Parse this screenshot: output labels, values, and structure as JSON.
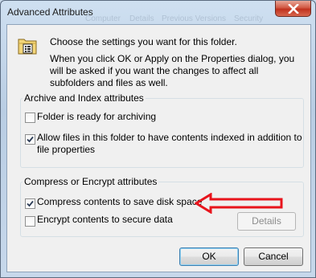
{
  "window": {
    "title": "Advanced Attributes",
    "background_ghost_text": [
      "Computer",
      "Details",
      "Previous Versions",
      "Security"
    ]
  },
  "info": {
    "line1": "Choose the settings you want for this folder.",
    "line2": "When you click OK or Apply on the Properties dialog, you will be asked if you want the changes to affect all subfolders and files as well."
  },
  "archive_group": {
    "label": "Archive and Index attributes",
    "folder_ready_archiving": {
      "label": "Folder is ready for archiving",
      "checked": false
    },
    "allow_indexing": {
      "label": "Allow files in this folder to have contents indexed in addition to file properties",
      "checked": true
    }
  },
  "compress_group": {
    "label": "Compress or Encrypt attributes",
    "compress": {
      "label": "Compress contents to save disk space",
      "checked": true
    },
    "encrypt": {
      "label": "Encrypt contents to secure data",
      "checked": false
    },
    "details_label": "Details"
  },
  "buttons": {
    "ok": "OK",
    "cancel": "Cancel"
  },
  "colors": {
    "annotation_arrow": "#e8141c",
    "close_button": "#c7392a",
    "ok_focus": "#3c7fb1"
  },
  "icons": [
    "folder-settings-icon",
    "close-icon",
    "checkmark-icon",
    "annotation-arrow"
  ]
}
